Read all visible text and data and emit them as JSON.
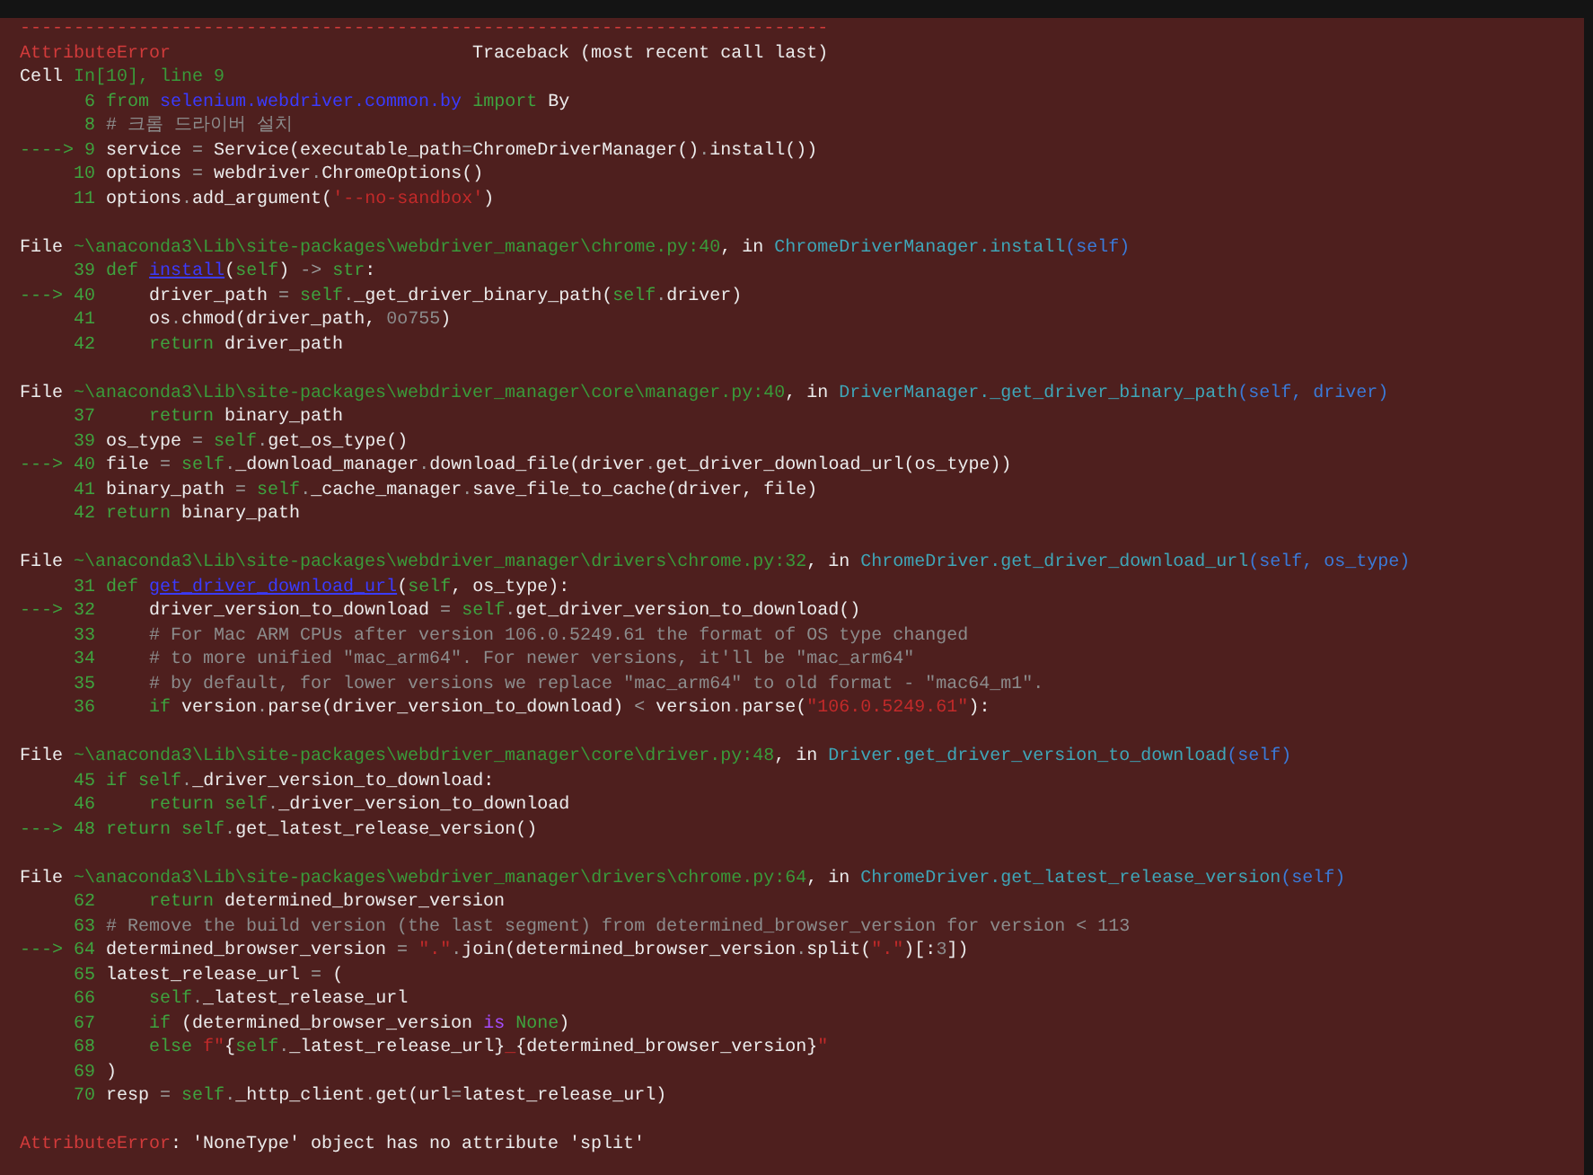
{
  "traceback": {
    "blocks": [
      {
        "lines": [
          [
            {
              "kind": "err",
              "text": "---------------------------------------------------------------------------"
            }
          ],
          [
            {
              "kind": "err",
              "text": "AttributeError"
            },
            {
              "kind": "text",
              "text": "                            Traceback (most recent call last)"
            }
          ],
          [
            {
              "kind": "text",
              "text": "Cell "
            },
            {
              "kind": "path",
              "text": "In[10], line 9"
            }
          ],
          [
            {
              "kind": "num",
              "text": "      6 "
            },
            {
              "kind": "kw",
              "text": "from "
            },
            {
              "kind": "module",
              "text": "selenium.webdriver.common.by"
            },
            {
              "kind": "kw",
              "text": " import "
            },
            {
              "kind": "text",
              "text": "By"
            }
          ],
          [
            {
              "kind": "num",
              "text": "      8 "
            },
            {
              "kind": "comment",
              "text": "# 크롬 드라이버 설치"
            }
          ],
          [
            {
              "kind": "arrow",
              "text": "----> 9 "
            },
            {
              "kind": "text",
              "text": "service "
            },
            {
              "kind": "op",
              "text": "= "
            },
            {
              "kind": "text",
              "text": "Service(executable_path"
            },
            {
              "kind": "op",
              "text": "="
            },
            {
              "kind": "text",
              "text": "ChromeDriverManager()"
            },
            {
              "kind": "op",
              "text": "."
            },
            {
              "kind": "text",
              "text": "install())"
            }
          ],
          [
            {
              "kind": "num",
              "text": "     10 "
            },
            {
              "kind": "text",
              "text": "options "
            },
            {
              "kind": "op",
              "text": "= "
            },
            {
              "kind": "text",
              "text": "webdriver"
            },
            {
              "kind": "op",
              "text": "."
            },
            {
              "kind": "text",
              "text": "ChromeOptions()"
            }
          ],
          [
            {
              "kind": "num",
              "text": "     11 "
            },
            {
              "kind": "text",
              "text": "options"
            },
            {
              "kind": "op",
              "text": "."
            },
            {
              "kind": "text",
              "text": "add_argument("
            },
            {
              "kind": "str",
              "text": "'--no-sandbox'"
            },
            {
              "kind": "text",
              "text": ")"
            }
          ]
        ]
      },
      {
        "lines": [
          [
            {
              "kind": "text",
              "text": "File "
            },
            {
              "kind": "path",
              "text": "~\\anaconda3\\Lib\\site-packages\\webdriver_manager\\chrome.py:40"
            },
            {
              "kind": "text",
              "text": ", in "
            },
            {
              "kind": "fn",
              "text": "ChromeDriverManager.install"
            },
            {
              "kind": "args",
              "text": "(self)"
            }
          ],
          [
            {
              "kind": "num",
              "text": "     39 "
            },
            {
              "kind": "kw",
              "text": "def "
            },
            {
              "kind": "def",
              "text": "install"
            },
            {
              "kind": "text",
              "text": "("
            },
            {
              "kind": "kw",
              "text": "self"
            },
            {
              "kind": "text",
              "text": ") "
            },
            {
              "kind": "op",
              "text": "-> "
            },
            {
              "kind": "kw",
              "text": "str"
            },
            {
              "kind": "text",
              "text": ":"
            }
          ],
          [
            {
              "kind": "arrow",
              "text": "---> 40 "
            },
            {
              "kind": "text",
              "text": "    driver_path "
            },
            {
              "kind": "op",
              "text": "= "
            },
            {
              "kind": "kw",
              "text": "self"
            },
            {
              "kind": "op",
              "text": "."
            },
            {
              "kind": "text",
              "text": "_get_driver_binary_path("
            },
            {
              "kind": "kw",
              "text": "self"
            },
            {
              "kind": "op",
              "text": "."
            },
            {
              "kind": "text",
              "text": "driver)"
            }
          ],
          [
            {
              "kind": "num",
              "text": "     41 "
            },
            {
              "kind": "text",
              "text": "    os"
            },
            {
              "kind": "op",
              "text": "."
            },
            {
              "kind": "text",
              "text": "chmod(driver_path, "
            },
            {
              "kind": "dim",
              "text": "0o755"
            },
            {
              "kind": "text",
              "text": ")"
            }
          ],
          [
            {
              "kind": "num",
              "text": "     42 "
            },
            {
              "kind": "kw",
              "text": "    return "
            },
            {
              "kind": "text",
              "text": "driver_path"
            }
          ]
        ]
      },
      {
        "lines": [
          [
            {
              "kind": "text",
              "text": "File "
            },
            {
              "kind": "path",
              "text": "~\\anaconda3\\Lib\\site-packages\\webdriver_manager\\core\\manager.py:40"
            },
            {
              "kind": "text",
              "text": ", in "
            },
            {
              "kind": "fn",
              "text": "DriverManager._get_driver_binary_path"
            },
            {
              "kind": "args",
              "text": "(self, driver)"
            }
          ],
          [
            {
              "kind": "num",
              "text": "     37 "
            },
            {
              "kind": "kw",
              "text": "    return "
            },
            {
              "kind": "text",
              "text": "binary_path"
            }
          ],
          [
            {
              "kind": "num",
              "text": "     39 "
            },
            {
              "kind": "text",
              "text": "os_type "
            },
            {
              "kind": "op",
              "text": "= "
            },
            {
              "kind": "kw",
              "text": "self"
            },
            {
              "kind": "op",
              "text": "."
            },
            {
              "kind": "text",
              "text": "get_os_type()"
            }
          ],
          [
            {
              "kind": "arrow",
              "text": "---> 40 "
            },
            {
              "kind": "text",
              "text": "file "
            },
            {
              "kind": "op",
              "text": "= "
            },
            {
              "kind": "kw",
              "text": "self"
            },
            {
              "kind": "op",
              "text": "."
            },
            {
              "kind": "text",
              "text": "_download_manager"
            },
            {
              "kind": "op",
              "text": "."
            },
            {
              "kind": "text",
              "text": "download_file(driver"
            },
            {
              "kind": "op",
              "text": "."
            },
            {
              "kind": "text",
              "text": "get_driver_download_url(os_type))"
            }
          ],
          [
            {
              "kind": "num",
              "text": "     41 "
            },
            {
              "kind": "text",
              "text": "binary_path "
            },
            {
              "kind": "op",
              "text": "= "
            },
            {
              "kind": "kw",
              "text": "self"
            },
            {
              "kind": "op",
              "text": "."
            },
            {
              "kind": "text",
              "text": "_cache_manager"
            },
            {
              "kind": "op",
              "text": "."
            },
            {
              "kind": "text",
              "text": "save_file_to_cache(driver, file)"
            }
          ],
          [
            {
              "kind": "num",
              "text": "     42 "
            },
            {
              "kind": "kw",
              "text": "return "
            },
            {
              "kind": "text",
              "text": "binary_path"
            }
          ]
        ]
      },
      {
        "lines": [
          [
            {
              "kind": "text",
              "text": "File "
            },
            {
              "kind": "path",
              "text": "~\\anaconda3\\Lib\\site-packages\\webdriver_manager\\drivers\\chrome.py:32"
            },
            {
              "kind": "text",
              "text": ", in "
            },
            {
              "kind": "fn",
              "text": "ChromeDriver.get_driver_download_url"
            },
            {
              "kind": "args",
              "text": "(self, os_type)"
            }
          ],
          [
            {
              "kind": "num",
              "text": "     31 "
            },
            {
              "kind": "kw",
              "text": "def "
            },
            {
              "kind": "def",
              "text": "get_driver_download_url"
            },
            {
              "kind": "text",
              "text": "("
            },
            {
              "kind": "kw",
              "text": "self"
            },
            {
              "kind": "text",
              "text": ", os_type):"
            }
          ],
          [
            {
              "kind": "arrow",
              "text": "---> 32 "
            },
            {
              "kind": "text",
              "text": "    driver_version_to_download "
            },
            {
              "kind": "op",
              "text": "= "
            },
            {
              "kind": "kw",
              "text": "self"
            },
            {
              "kind": "op",
              "text": "."
            },
            {
              "kind": "text",
              "text": "get_driver_version_to_download()"
            }
          ],
          [
            {
              "kind": "num",
              "text": "     33 "
            },
            {
              "kind": "comment",
              "text": "    # For Mac ARM CPUs after version 106.0.5249.61 the format of OS type changed"
            }
          ],
          [
            {
              "kind": "num",
              "text": "     34 "
            },
            {
              "kind": "comment",
              "text": "    # to more unified \"mac_arm64\". For newer versions, it'll be \"mac_arm64\""
            }
          ],
          [
            {
              "kind": "num",
              "text": "     35 "
            },
            {
              "kind": "comment",
              "text": "    # by default, for lower versions we replace \"mac_arm64\" to old format - \"mac64_m1\"."
            }
          ],
          [
            {
              "kind": "num",
              "text": "     36 "
            },
            {
              "kind": "kw",
              "text": "    if "
            },
            {
              "kind": "text",
              "text": "version"
            },
            {
              "kind": "op",
              "text": "."
            },
            {
              "kind": "text",
              "text": "parse(driver_version_to_download) "
            },
            {
              "kind": "op",
              "text": "< "
            },
            {
              "kind": "text",
              "text": "version"
            },
            {
              "kind": "op",
              "text": "."
            },
            {
              "kind": "text",
              "text": "parse("
            },
            {
              "kind": "str",
              "text": "\"106.0.5249.61\""
            },
            {
              "kind": "text",
              "text": "):"
            }
          ]
        ]
      },
      {
        "lines": [
          [
            {
              "kind": "text",
              "text": "File "
            },
            {
              "kind": "path",
              "text": "~\\anaconda3\\Lib\\site-packages\\webdriver_manager\\core\\driver.py:48"
            },
            {
              "kind": "text",
              "text": ", in "
            },
            {
              "kind": "fn",
              "text": "Driver.get_driver_version_to_download"
            },
            {
              "kind": "args",
              "text": "(self)"
            }
          ],
          [
            {
              "kind": "num",
              "text": "     45 "
            },
            {
              "kind": "kw",
              "text": "if "
            },
            {
              "kind": "kw",
              "text": "self"
            },
            {
              "kind": "op",
              "text": "."
            },
            {
              "kind": "text",
              "text": "_driver_version_to_download:"
            }
          ],
          [
            {
              "kind": "num",
              "text": "     46 "
            },
            {
              "kind": "kw",
              "text": "    return "
            },
            {
              "kind": "kw",
              "text": "self"
            },
            {
              "kind": "op",
              "text": "."
            },
            {
              "kind": "text",
              "text": "_driver_version_to_download"
            }
          ],
          [
            {
              "kind": "arrow",
              "text": "---> 48 "
            },
            {
              "kind": "kw",
              "text": "return "
            },
            {
              "kind": "kw",
              "text": "self"
            },
            {
              "kind": "op",
              "text": "."
            },
            {
              "kind": "text",
              "text": "get_latest_release_version()"
            }
          ]
        ]
      },
      {
        "lines": [
          [
            {
              "kind": "text",
              "text": "File "
            },
            {
              "kind": "path",
              "text": "~\\anaconda3\\Lib\\site-packages\\webdriver_manager\\drivers\\chrome.py:64"
            },
            {
              "kind": "text",
              "text": ", in "
            },
            {
              "kind": "fn",
              "text": "ChromeDriver.get_latest_release_version"
            },
            {
              "kind": "args",
              "text": "(self)"
            }
          ],
          [
            {
              "kind": "num",
              "text": "     62 "
            },
            {
              "kind": "kw",
              "text": "    return "
            },
            {
              "kind": "text",
              "text": "determined_browser_version"
            }
          ],
          [
            {
              "kind": "num",
              "text": "     63 "
            },
            {
              "kind": "comment",
              "text": "# Remove the build version (the last segment) from determined_browser_version for version < 113"
            }
          ],
          [
            {
              "kind": "arrow",
              "text": "---> 64 "
            },
            {
              "kind": "text",
              "text": "determined_browser_version "
            },
            {
              "kind": "op",
              "text": "= "
            },
            {
              "kind": "str",
              "text": "\".\""
            },
            {
              "kind": "op",
              "text": "."
            },
            {
              "kind": "text",
              "text": "join(determined_browser_version"
            },
            {
              "kind": "op",
              "text": "."
            },
            {
              "kind": "text",
              "text": "split("
            },
            {
              "kind": "str",
              "text": "\".\""
            },
            {
              "kind": "text",
              "text": ")[:"
            },
            {
              "kind": "dim",
              "text": "3"
            },
            {
              "kind": "text",
              "text": "])"
            }
          ],
          [
            {
              "kind": "num",
              "text": "     65 "
            },
            {
              "kind": "text",
              "text": "latest_release_url "
            },
            {
              "kind": "op",
              "text": "= "
            },
            {
              "kind": "text",
              "text": "("
            }
          ],
          [
            {
              "kind": "num",
              "text": "     66 "
            },
            {
              "kind": "kw",
              "text": "    self"
            },
            {
              "kind": "op",
              "text": "."
            },
            {
              "kind": "text",
              "text": "_latest_release_url"
            }
          ],
          [
            {
              "kind": "num",
              "text": "     67 "
            },
            {
              "kind": "kw",
              "text": "    if "
            },
            {
              "kind": "text",
              "text": "(determined_browser_version "
            },
            {
              "kind": "purple",
              "text": "is "
            },
            {
              "kind": "kw",
              "text": "None"
            },
            {
              "kind": "text",
              "text": ")"
            }
          ],
          [
            {
              "kind": "num",
              "text": "     68 "
            },
            {
              "kind": "kw",
              "text": "    else "
            },
            {
              "kind": "str",
              "text": "f\""
            },
            {
              "kind": "text",
              "text": "{"
            },
            {
              "kind": "kw",
              "text": "self"
            },
            {
              "kind": "op",
              "text": "."
            },
            {
              "kind": "text",
              "text": "_latest_release_url}"
            },
            {
              "kind": "str",
              "text": "_"
            },
            {
              "kind": "text",
              "text": "{determined_browser_version}"
            },
            {
              "kind": "str",
              "text": "\""
            }
          ],
          [
            {
              "kind": "num",
              "text": "     69 "
            },
            {
              "kind": "text",
              "text": ")"
            }
          ],
          [
            {
              "kind": "num",
              "text": "     70 "
            },
            {
              "kind": "text",
              "text": "resp "
            },
            {
              "kind": "op",
              "text": "= "
            },
            {
              "kind": "kw",
              "text": "self"
            },
            {
              "kind": "op",
              "text": "."
            },
            {
              "kind": "text",
              "text": "_http_client"
            },
            {
              "kind": "op",
              "text": "."
            },
            {
              "kind": "text",
              "text": "get(url"
            },
            {
              "kind": "op",
              "text": "="
            },
            {
              "kind": "text",
              "text": "latest_release_url)"
            }
          ]
        ]
      },
      {
        "lines": [
          [
            {
              "kind": "err",
              "text": "AttributeError"
            },
            {
              "kind": "text",
              "text": ": 'NoneType' object has no attribute 'split'"
            }
          ]
        ]
      }
    ]
  }
}
